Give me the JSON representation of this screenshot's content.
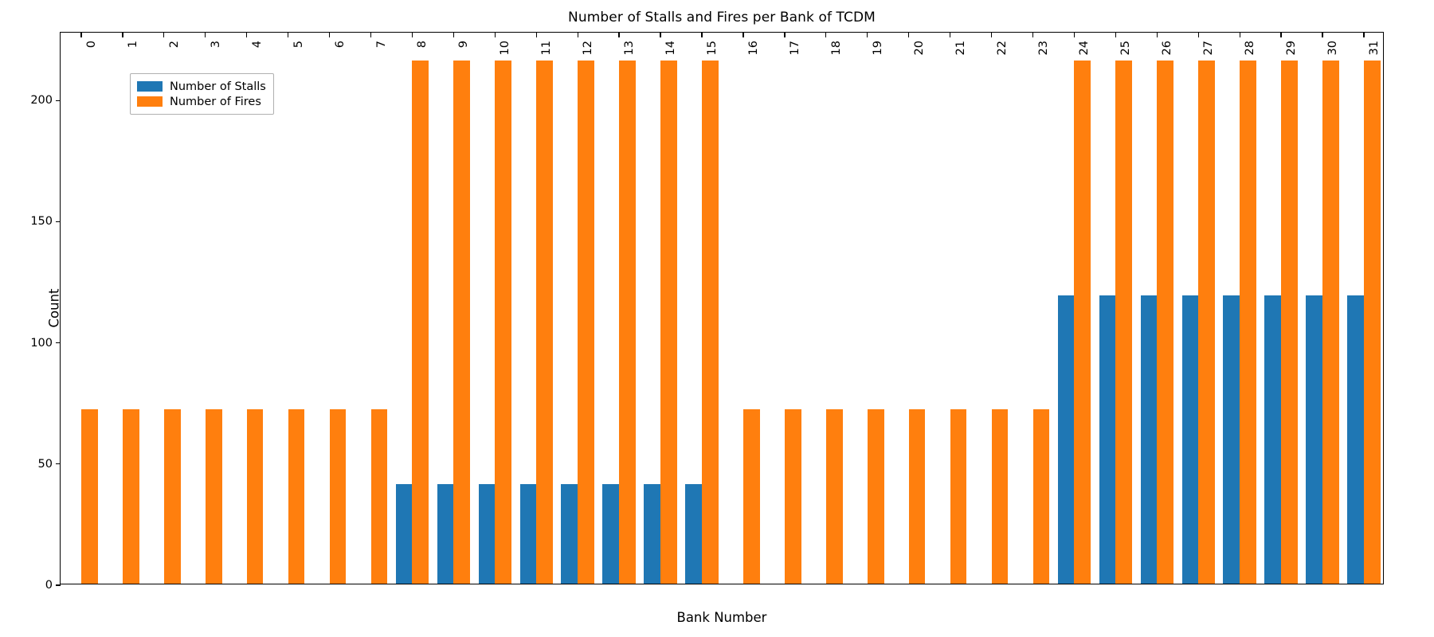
{
  "chart_data": {
    "type": "bar",
    "title": "Number of Stalls and Fires per Bank of TCDM",
    "xlabel": "Bank Number",
    "ylabel": "Count",
    "grid": false,
    "legend_position": "upper left",
    "categories": [
      "0",
      "1",
      "2",
      "3",
      "4",
      "5",
      "6",
      "7",
      "8",
      "9",
      "10",
      "11",
      "12",
      "13",
      "14",
      "15",
      "16",
      "17",
      "18",
      "19",
      "20",
      "21",
      "22",
      "23",
      "24",
      "25",
      "26",
      "27",
      "28",
      "29",
      "30",
      "31"
    ],
    "xlim": [
      -0.5,
      31.5
    ],
    "ylim": [
      0,
      228
    ],
    "ytick_labels": [
      "0",
      "50",
      "100",
      "150",
      "200"
    ],
    "ytick_values": [
      0,
      50,
      100,
      150,
      200
    ],
    "series": [
      {
        "name": "Number of Stalls",
        "color": "#1f77b4",
        "values": [
          0,
          0,
          0,
          0,
          0,
          0,
          0,
          0,
          41,
          41,
          41,
          41,
          41,
          41,
          41,
          41,
          0,
          0,
          0,
          0,
          0,
          0,
          0,
          0,
          119,
          119,
          119,
          119,
          119,
          119,
          119,
          119
        ]
      },
      {
        "name": "Number of Fires",
        "color": "#ff7f0e",
        "values": [
          72,
          72,
          72,
          72,
          72,
          72,
          72,
          72,
          216,
          216,
          216,
          216,
          216,
          216,
          216,
          216,
          72,
          72,
          72,
          72,
          72,
          72,
          72,
          72,
          216,
          216,
          216,
          216,
          216,
          216,
          216,
          216
        ]
      }
    ]
  },
  "legend": {
    "items": [
      {
        "label": "Number of Stalls",
        "key": "stalls"
      },
      {
        "label": "Number of Fires",
        "key": "fires"
      }
    ]
  }
}
